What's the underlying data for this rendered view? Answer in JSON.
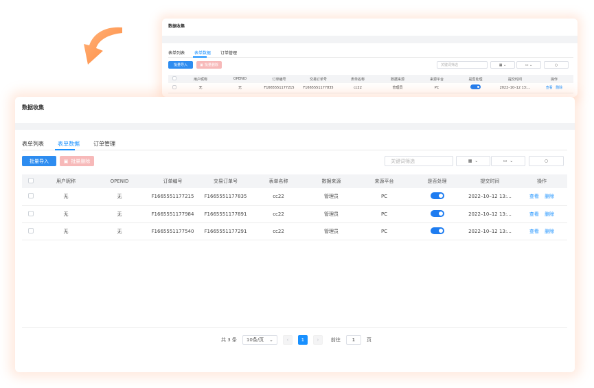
{
  "window_title": "数据收集",
  "tabs": [
    {
      "label": "表单列表",
      "active": false
    },
    {
      "label": "表单数据",
      "active": true
    },
    {
      "label": "订单管理",
      "active": false
    }
  ],
  "toolbar": {
    "import_label": "批量导入",
    "delete_label": "批量删除",
    "search_placeholder": "关键词筛选",
    "grid_icon": "grid-icon",
    "folder_icon": "folder-icon",
    "search_icon": "search-icon"
  },
  "table": {
    "columns": [
      "用户昵称",
      "OPENID",
      "订单编号",
      "交易订单号",
      "表单名称",
      "数据来源",
      "来源平台",
      "是否处理",
      "提交时间",
      "操作"
    ],
    "rows": [
      {
        "nickname": "无",
        "openid": "无",
        "order_no": "F1665551177215",
        "trade_no": "F1665551177835",
        "form_name": "cc22",
        "source": "管理员",
        "platform": "PC",
        "processed": true,
        "time": "2022–10–12 13:...",
        "view": "查看",
        "delete": "删除"
      },
      {
        "nickname": "无",
        "openid": "无",
        "order_no": "F1665551177984",
        "trade_no": "F1665551177891",
        "form_name": "cc22",
        "source": "管理员",
        "platform": "PC",
        "processed": true,
        "time": "2022–10–12 13:...",
        "view": "查看",
        "delete": "删除"
      },
      {
        "nickname": "无",
        "openid": "无",
        "order_no": "F1665551177540",
        "trade_no": "F1665551177291",
        "form_name": "cc22",
        "source": "管理员",
        "platform": "PC",
        "processed": true,
        "time": "2022–10–12 13:...",
        "view": "查看",
        "delete": "删除"
      }
    ]
  },
  "pagination": {
    "total_label": "共 3 条",
    "page_size": "10条/页",
    "current_page": "1",
    "goto_label": "前往",
    "goto_value": "1",
    "page_suffix": "页"
  },
  "colors": {
    "accent": "#1890ff",
    "primary_button": "#2d8cf0",
    "danger_button": "#f7b9b9",
    "arrow": "#ff9a52"
  }
}
